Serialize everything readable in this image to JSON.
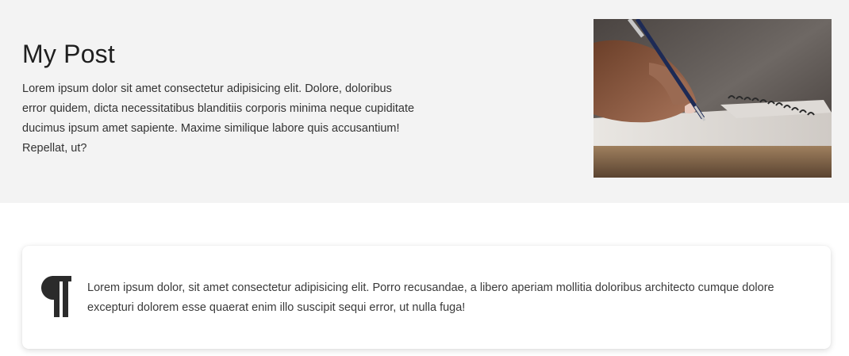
{
  "hero": {
    "title": "My Post",
    "body": "Lorem ipsum dolor sit amet consectetur adipisicing elit. Dolore, doloribus error quidem, dicta necessitatibus blanditiis corporis minima neque cupiditate ducimus ipsum amet sapiente. Maxime similique labore quis accusantium! Repellat, ut?",
    "image_subject": "hand writing with pen in notebook"
  },
  "card": {
    "icon": "pilcrow-icon",
    "text": "Lorem ipsum dolor, sit amet consectetur adipisicing elit. Porro recusandae, a libero aperiam mollitia doloribus architecto cumque dolore excepturi dolorem esse quaerat enim illo suscipit sequi error, ut nulla fuga!"
  },
  "colors": {
    "hero_background": "#f3f3f3",
    "page_background": "#ffffff",
    "text": "#333333",
    "icon": "#2b2b2b"
  }
}
